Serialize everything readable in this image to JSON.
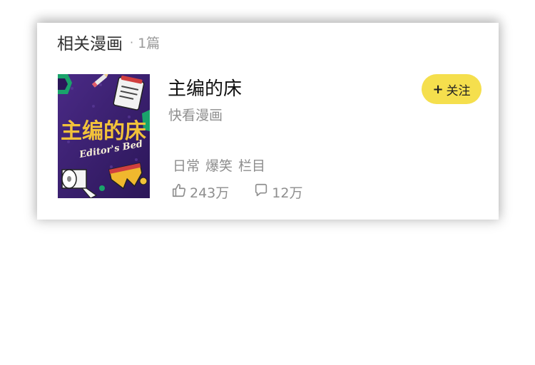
{
  "section": {
    "title": "相关漫画",
    "separator": "·",
    "count": "1篇"
  },
  "comic": {
    "title": "主编的床",
    "publisher": "快看漫画",
    "cover_text_main": "主编的床",
    "cover_text_sub": "Editor's Bed",
    "tags": [
      "日常",
      "爆笑",
      "栏目"
    ],
    "likes": "243万",
    "comments": "12万"
  },
  "follow_button": {
    "plus": "+",
    "label": "关注"
  },
  "colors": {
    "follow_bg": "#f5df4d",
    "cover_bg": "#3a1f6e",
    "cover_title": "#f2c23a"
  }
}
